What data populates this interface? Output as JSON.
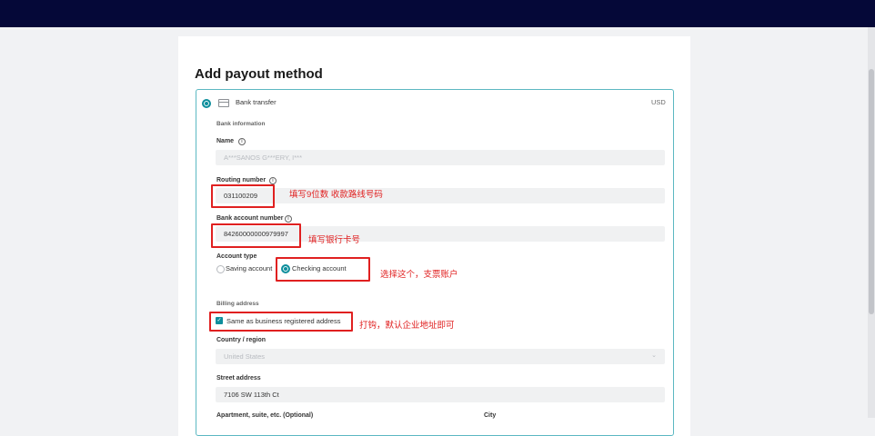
{
  "page_title": "Add payout method",
  "method": {
    "label": "Bank transfer",
    "currency": "USD"
  },
  "bank_section": "Bank information",
  "name": {
    "label": "Name",
    "value": "A***SANOS G***ERY, I***"
  },
  "routing": {
    "label": "Routing number",
    "value": "031100209",
    "note": "填写9位数 收款路线号码"
  },
  "account": {
    "label": "Bank account number",
    "value": "84260000000979997",
    "note": "填写银行卡号"
  },
  "account_type": {
    "label": "Account type",
    "saving": "Saving account",
    "checking": "Checking account",
    "note": "选择这个，支票账户"
  },
  "billing": {
    "section": "Billing address",
    "same_as": "Same as business registered address",
    "note": "打钩，默认企业地址即可",
    "country_label": "Country / region",
    "country_value": "United States",
    "street_label": "Street address",
    "street_value": "7106 SW 113th Ct",
    "apt_label": "Apartment, suite, etc. (Optional)",
    "city_label": "City"
  },
  "icons": {
    "radio": "radio-selected-icon",
    "card": "bank-card-icon",
    "info": "info-icon",
    "chevron": "chevron-down-icon",
    "check": "checkbox-checked-icon"
  },
  "colors": {
    "topbar": "#050838",
    "accent": "#0d8e9c",
    "annotation": "#e02020",
    "border": "#5cb8c2"
  }
}
